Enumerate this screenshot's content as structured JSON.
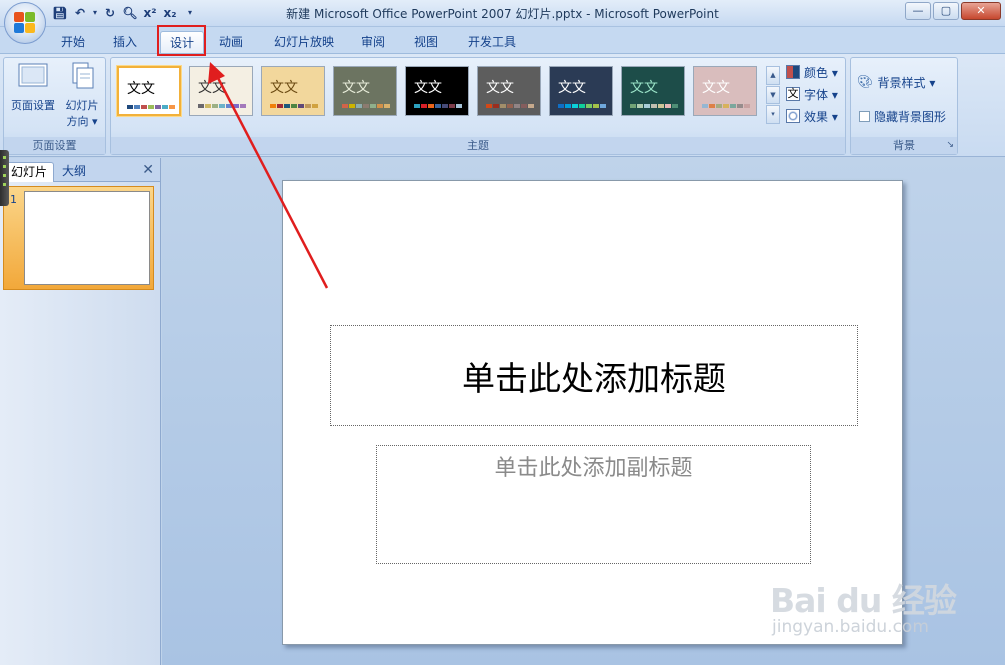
{
  "window": {
    "title": "新建 Microsoft Office PowerPoint 2007 幻灯片.pptx - Microsoft PowerPoint",
    "buttons": {
      "minimize": "—",
      "maximize": "▢",
      "close": "✕"
    }
  },
  "quick_access": {
    "icons": [
      "save-icon",
      "undo-icon",
      "redo-icon",
      "print-preview-icon",
      "superscript-icon",
      "subscript-icon",
      "customize-icon"
    ]
  },
  "tabs": [
    {
      "label": "开始"
    },
    {
      "label": "插入"
    },
    {
      "label": "设计",
      "active": true
    },
    {
      "label": "动画"
    },
    {
      "label": "幻灯片放映"
    },
    {
      "label": "审阅"
    },
    {
      "label": "视图"
    },
    {
      "label": "开发工具"
    }
  ],
  "ribbon": {
    "page_setup": {
      "label": "页面设置",
      "page_setup_btn": "页面设置",
      "orientation_line1": "幻灯片",
      "orientation_line2": "方向 ▾"
    },
    "themes": {
      "label": "主题",
      "sample_text": "文文",
      "items": [
        {
          "name": "office",
          "bg": "#ffffff",
          "fg": "#000000",
          "swatches": [
            "#1f497d",
            "#4f81bd",
            "#c0504d",
            "#9bbb59",
            "#8064a2",
            "#4bacc6",
            "#f79646"
          ]
        },
        {
          "name": "apex",
          "bg": "#f4efe3",
          "fg": "#333333",
          "swatches": [
            "#69676d",
            "#ceb966",
            "#9cb084",
            "#6bb1c9",
            "#6585cf",
            "#7e6bc9",
            "#a379bb"
          ]
        },
        {
          "name": "aspect",
          "bg": "#f2d79c",
          "fg": "#6b4a12",
          "swatches": [
            "#f07f09",
            "#9f2936",
            "#1b587c",
            "#4e8542",
            "#604878",
            "#c19859",
            "#d1a23f"
          ]
        },
        {
          "name": "civic",
          "bg": "#6c7461",
          "fg": "#e8edda",
          "swatches": [
            "#d16349",
            "#ccb400",
            "#8cadae",
            "#8c7b70",
            "#8fb08c",
            "#d19049",
            "#d9b16b"
          ]
        },
        {
          "name": "concourse",
          "bg": "#000000",
          "fg": "#ffffff",
          "swatches": [
            "#2da2bf",
            "#da1f28",
            "#eb641b",
            "#39639d",
            "#474b78",
            "#7d3c4a",
            "#a3c0d6"
          ]
        },
        {
          "name": "equity",
          "bg": "#5d5d5d",
          "fg": "#ffffff",
          "swatches": [
            "#d34817",
            "#9b2d1f",
            "#a28e6a",
            "#956251",
            "#918485",
            "#855d5d",
            "#c6a98c"
          ]
        },
        {
          "name": "flow",
          "bg": "#2b3b55",
          "fg": "#ffffff",
          "swatches": [
            "#0f6fc6",
            "#009dd9",
            "#0bd0d9",
            "#10cf9b",
            "#7cca62",
            "#a5c249",
            "#6fa8dc"
          ]
        },
        {
          "name": "foundry",
          "bg": "#1d4d49",
          "fg": "#9be3c8",
          "swatches": [
            "#72a376",
            "#b0ccb0",
            "#a8cdd7",
            "#c0beaf",
            "#cec597",
            "#e8b7b7",
            "#4f8e76"
          ]
        },
        {
          "name": "median",
          "bg": "#d9bdbd",
          "fg": "#ffffff",
          "swatches": [
            "#94b6d2",
            "#dd8047",
            "#a5ab81",
            "#d8b25c",
            "#7ba79d",
            "#968c8c",
            "#c8a2a2"
          ]
        }
      ],
      "colors": "颜色 ▾",
      "fonts": "字体 ▾",
      "effects": "效果 ▾"
    },
    "background": {
      "label": "背景",
      "styles": "背景样式 ▾",
      "hide_graphics": "隐藏背景图形",
      "hide_graphics_checked": false
    }
  },
  "left_pane": {
    "tab_slides": "幻灯片",
    "tab_outline": "大纲",
    "close": "✕",
    "slide_number": "1"
  },
  "slide": {
    "title_placeholder": "单击此处添加标题",
    "subtitle_placeholder": "单击此处添加副标题"
  },
  "watermark": {
    "brand": "Bai du 经验",
    "url": "jingyan.baidu.com"
  },
  "colors": {
    "annotation": "#e01e1e",
    "selected_theme_border": "#f2b13a"
  }
}
